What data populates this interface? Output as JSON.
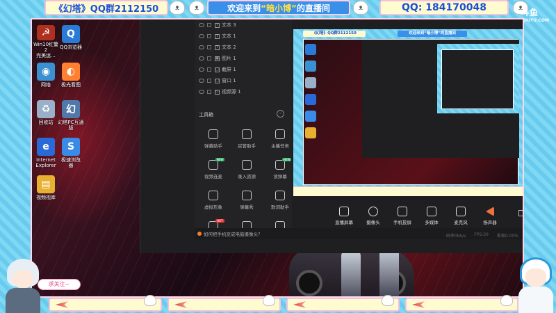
{
  "overlay": {
    "banner_left": "《幻塔》QQ群2112150",
    "banner_mid_prefix": "欢迎来到",
    "banner_mid_highlight": "“暗小博”",
    "banner_mid_suffix": "的直播间",
    "banner_right": "QQ: 184170048",
    "brand": "斗鱼",
    "brand_sub": "DOUYU.COM",
    "bubble_text": "求关注~"
  },
  "desktop": {
    "icons": [
      {
        "label": "Win10红警2\n完美运...",
        "icon": "red-alert-icon",
        "color": "#b03020",
        "glyph": "☭"
      },
      {
        "label": "QQ浏览器",
        "icon": "qq-browser-icon",
        "color": "#2a7ad8",
        "glyph": "Q"
      },
      {
        "label": "网络",
        "icon": "network-icon",
        "color": "#3a90d0",
        "glyph": "◉"
      },
      {
        "label": "极光看图",
        "icon": "image-viewer-icon",
        "color": "#ff8030",
        "glyph": "◐"
      },
      {
        "label": "回收站",
        "icon": "recycle-bin-icon",
        "color": "#9ab0c8",
        "glyph": "♻"
      },
      {
        "label": "幻塔PC互通\n版",
        "icon": "tower-of-fantasy-icon",
        "color": "#5078a8",
        "glyph": "幻"
      },
      {
        "label": "Internet\nExplorer",
        "icon": "ie-icon",
        "color": "#2a6ad8",
        "glyph": "e"
      },
      {
        "label": "极速浏览\n器",
        "icon": "speed-browser-icon",
        "color": "#3a8ae8",
        "glyph": "S"
      },
      {
        "label": "视频视库",
        "icon": "folder-icon",
        "color": "#e8b030",
        "glyph": "▤"
      }
    ]
  },
  "app": {
    "layers": [
      {
        "name": "文本 3",
        "type": "T"
      },
      {
        "name": "文本 1",
        "type": "T"
      },
      {
        "name": "文本 2",
        "type": "T"
      },
      {
        "name": "图片 1",
        "type": "▣"
      },
      {
        "name": "截屏 1",
        "type": "▢"
      },
      {
        "name": "窗口 1",
        "type": "▢"
      },
      {
        "name": "视频源 1",
        "type": "▷"
      }
    ],
    "tools_title": "工具箱",
    "tools_more": "···",
    "tools": [
      {
        "label": "弹幕助手",
        "badge": ""
      },
      {
        "label": "房管助手",
        "badge": ""
      },
      {
        "label": "主播任务",
        "badge": ""
      },
      {
        "label": "视频连麦",
        "badge": "NEW"
      },
      {
        "label": "录入资源",
        "badge": ""
      },
      {
        "label": "读弹幕",
        "badge": "NEW"
      },
      {
        "label": "虚拟形象",
        "badge": ""
      },
      {
        "label": "弹幕秀",
        "badge": ""
      },
      {
        "label": "歌词助手",
        "badge": ""
      },
      {
        "label": "",
        "badge": "HOT"
      },
      {
        "label": "",
        "badge": ""
      },
      {
        "label": "",
        "badge": ""
      }
    ],
    "tip": "如何把手机变成电脑摄像头？",
    "status": [
      "码率0kb/s",
      "FPS:30",
      "丢帧0.00%"
    ],
    "controls": [
      {
        "label": "直播屏幕",
        "icon": "screen-share-icon"
      },
      {
        "label": "摄像头",
        "icon": "camera-icon"
      },
      {
        "label": "手机投屏",
        "icon": "phone-cast-icon"
      },
      {
        "label": "多媒体",
        "icon": "media-icon"
      },
      {
        "label": "麦克风",
        "icon": "microphone-icon"
      },
      {
        "label": "扬声器",
        "icon": "speaker-icon"
      }
    ]
  },
  "colors": {
    "frame": "#6fd0f0",
    "banner_bg": "#fffbd0",
    "banner_text": "#1a4fd8",
    "app_bg": "#1f1f22"
  }
}
